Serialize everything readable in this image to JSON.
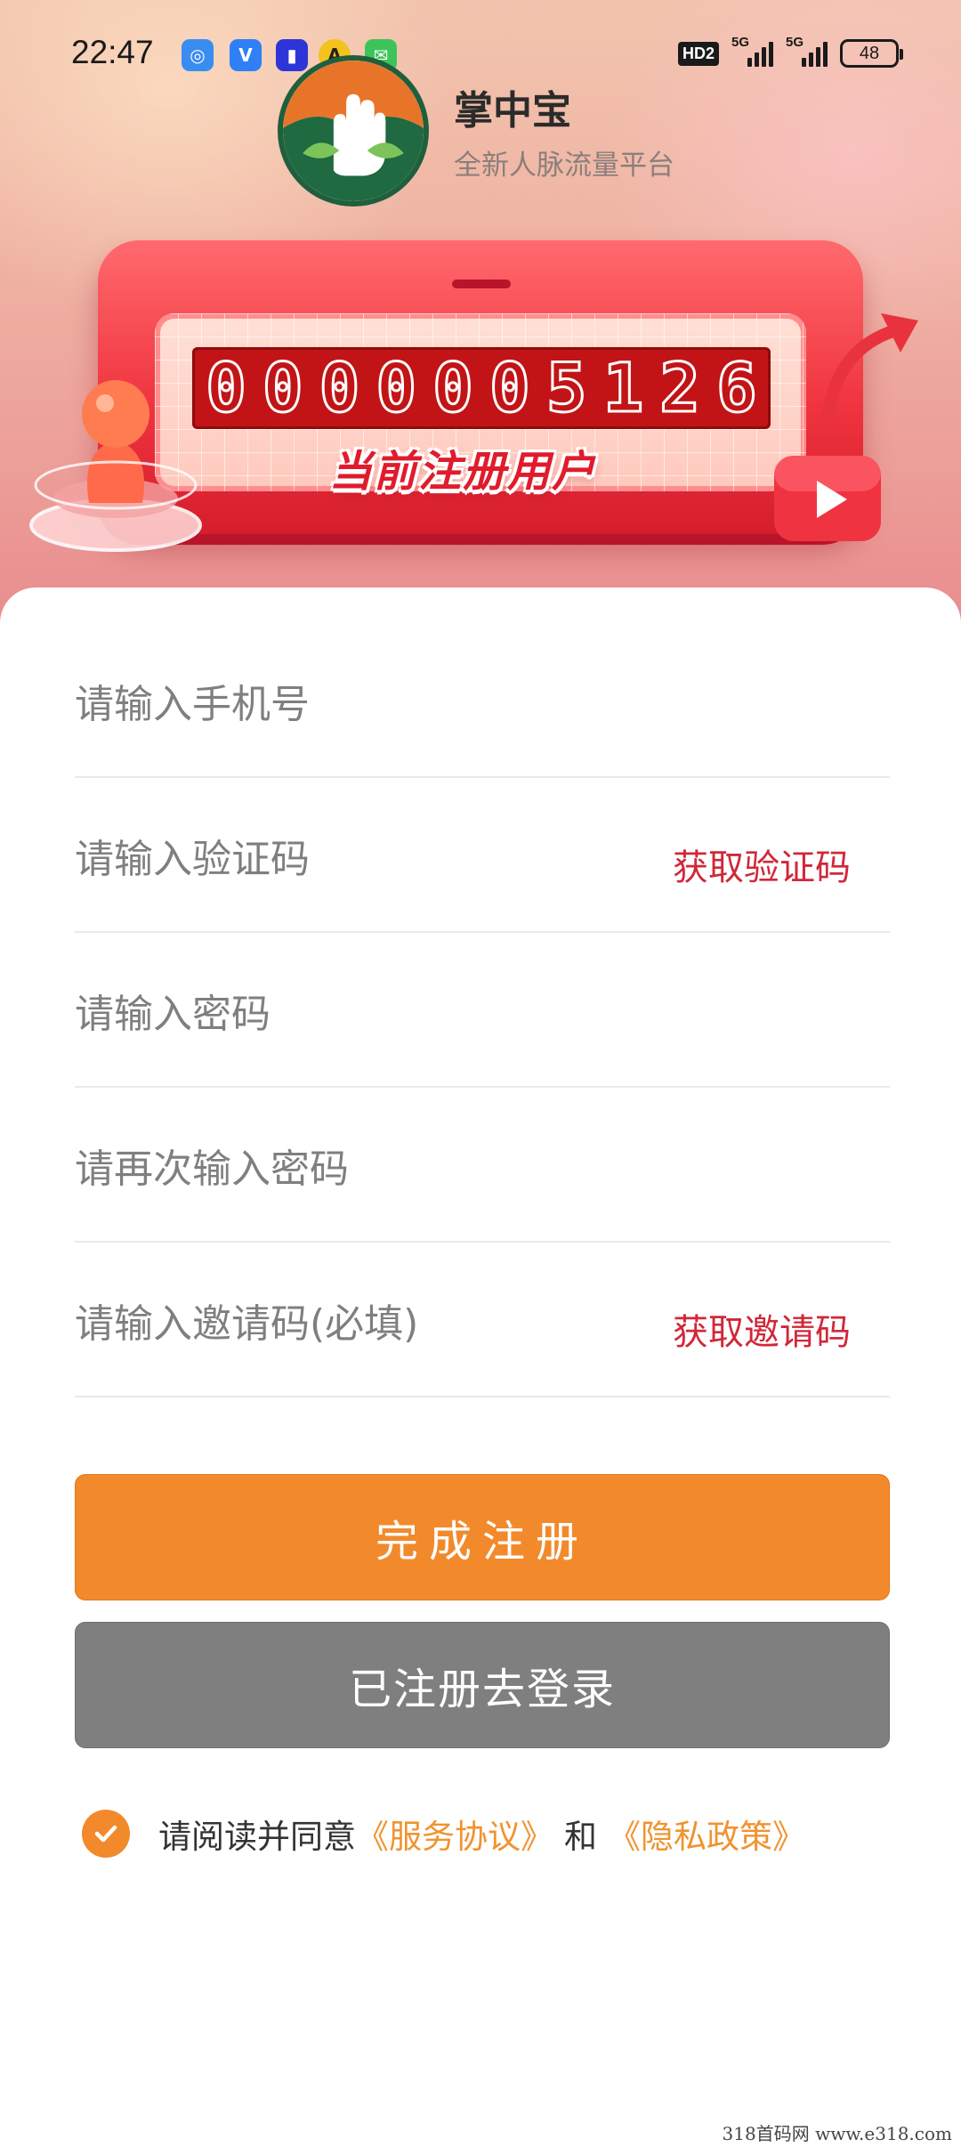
{
  "status_bar": {
    "time": "22:47",
    "hd_label": "HD2",
    "signal1_label": "5G",
    "signal2_label": "5G",
    "battery": "48"
  },
  "brand": {
    "name": "掌中宝",
    "slogan": "全新人脉流量平台"
  },
  "counter": {
    "digits": [
      "0",
      "0",
      "0",
      "0",
      "0",
      "0",
      "5",
      "1",
      "2",
      "6"
    ],
    "caption": "当前注册用户"
  },
  "form": {
    "phone_placeholder": "请输入手机号",
    "code_placeholder": "请输入验证码",
    "get_code_label": "获取验证码",
    "password_placeholder": "请输入密码",
    "password_confirm_placeholder": "请再次输入密码",
    "invite_placeholder": "请输入邀请码(必填)",
    "get_invite_label": "获取邀请码"
  },
  "actions": {
    "register_label": "完成注册",
    "login_label": "已注册去登录"
  },
  "agreement": {
    "checked": true,
    "prefix": "请阅读并同意",
    "service_link": "《服务协议》",
    "joiner": "和",
    "privacy_link": "《隐私政策》"
  },
  "watermark": "318首码网 www.e318.com",
  "colors": {
    "primary_orange": "#f28a2c",
    "link_red": "#d0283a",
    "secondary_gray": "#7f7f7f",
    "panel_red": "#f0353f"
  }
}
